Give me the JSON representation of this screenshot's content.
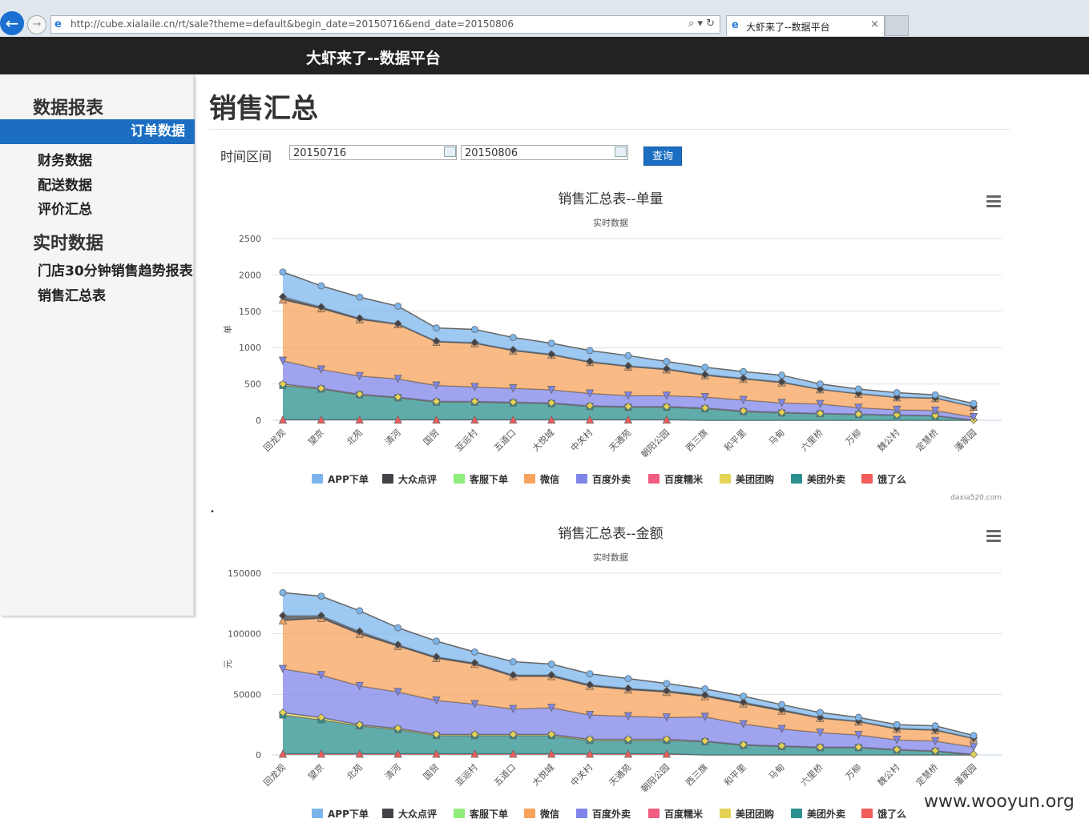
{
  "browser": {
    "url": "http://cube.xialaile.cn/rt/sale?theme=default&begin_date=20150716&end_date=20150806",
    "tab_title": "大虾来了--数据平台",
    "tab_close": "×",
    "search_glyph": "⌕ ▾ ↻"
  },
  "navbar": {
    "brand": "大虾来了--数据平台"
  },
  "sidebar": {
    "section1": "数据报表",
    "active_item": "订单数据",
    "items1": [
      "财务数据",
      "配送数据",
      "评价汇总"
    ],
    "section2": "实时数据",
    "items2": [
      "门店30分钟销售趋势报表",
      "销售汇总表"
    ]
  },
  "main": {
    "title": "销售汇总",
    "range_label": "时间区间",
    "begin_date": "20150716",
    "end_date": "20150806",
    "query_label": "查询",
    "bullet": "•",
    "credit": "daxia520.com"
  },
  "watermark": "www.wooyun.org",
  "colors": {
    "APP下单": "#7cb5ec",
    "大众点评": "#434348",
    "客服下单": "#90ed7d",
    "微信": "#f7a35c",
    "百度外卖": "#8085e9",
    "百度糯米": "#f15c80",
    "美团团购": "#e4d354",
    "美团外卖": "#2b908f",
    "饿了么": "#f45b5b"
  },
  "chart_data": [
    {
      "type": "area",
      "stacked": true,
      "title": "销售汇总表--单量",
      "subtitle": "实时数据",
      "ylabel": "单",
      "ylim": [
        0,
        2500
      ],
      "yticks": [
        0,
        500,
        1000,
        1500,
        2000,
        2500
      ],
      "grid": true,
      "legend_position": "bottom",
      "categories": [
        "回龙观",
        "望京",
        "北苑",
        "清河",
        "国贸",
        "亚运村",
        "五道口",
        "大悦城",
        "中关村",
        "天通苑",
        "朝阳公园",
        "西三旗",
        "和平里",
        "马甸",
        "六里桥",
        "万柳",
        "魏公村",
        "定慧桥",
        "潘家园"
      ],
      "series": [
        {
          "name": "APP下单",
          "values": [
            340,
            290,
            290,
            240,
            180,
            180,
            170,
            150,
            150,
            140,
            100,
            100,
            90,
            90,
            70,
            60,
            60,
            40,
            40
          ]
        },
        {
          "name": "大众点评",
          "values": [
            40,
            20,
            15,
            10,
            10,
            10,
            10,
            10,
            10,
            10,
            10,
            10,
            10,
            10,
            5,
            5,
            5,
            5,
            5
          ]
        },
        {
          "name": "客服下单",
          "values": [
            0,
            0,
            0,
            0,
            0,
            0,
            0,
            0,
            0,
            0,
            0,
            0,
            0,
            0,
            0,
            0,
            0,
            0,
            0
          ]
        },
        {
          "name": "微信",
          "values": [
            840,
            840,
            780,
            750,
            600,
            600,
            520,
            480,
            430,
            400,
            360,
            300,
            290,
            280,
            200,
            190,
            170,
            170,
            140
          ]
        },
        {
          "name": "百度外卖",
          "values": [
            320,
            260,
            250,
            250,
            220,
            200,
            190,
            180,
            170,
            150,
            150,
            150,
            150,
            130,
            130,
            90,
            70,
            70,
            40
          ]
        },
        {
          "name": "百度糯米",
          "values": [
            0,
            0,
            0,
            0,
            0,
            0,
            0,
            0,
            0,
            0,
            0,
            0,
            0,
            0,
            0,
            0,
            0,
            0,
            0
          ]
        },
        {
          "name": "美团团购",
          "values": [
            20,
            10,
            10,
            10,
            10,
            10,
            10,
            10,
            10,
            10,
            10,
            10,
            10,
            10,
            5,
            5,
            5,
            5,
            5
          ]
        },
        {
          "name": "美团外卖",
          "values": [
            470,
            420,
            340,
            300,
            240,
            240,
            230,
            220,
            180,
            170,
            170,
            160,
            120,
            100,
            90,
            80,
            70,
            60,
            0
          ]
        },
        {
          "name": "饿了么",
          "values": [
            10,
            10,
            10,
            10,
            10,
            10,
            10,
            10,
            10,
            10,
            10,
            0,
            0,
            0,
            0,
            0,
            0,
            0,
            0
          ]
        }
      ]
    },
    {
      "type": "area",
      "stacked": true,
      "title": "销售汇总表--金额",
      "subtitle": "实时数据",
      "ylabel": "元",
      "ylim": [
        0,
        150000
      ],
      "yticks": [
        0,
        50000,
        100000,
        150000
      ],
      "grid": true,
      "legend_position": "bottom",
      "categories": [
        "回龙观",
        "望京",
        "北苑",
        "清河",
        "国贸",
        "亚运村",
        "五道口",
        "大悦城",
        "中关村",
        "天通苑",
        "朝阳公园",
        "西三旗",
        "和平里",
        "马甸",
        "六里桥",
        "万柳",
        "魏公村",
        "定慧桥",
        "潘家园"
      ],
      "series": [
        {
          "name": "APP下单",
          "values": [
            19000,
            16000,
            17000,
            14000,
            13000,
            9000,
            11000,
            9000,
            9000,
            8000,
            6000,
            5000,
            5000,
            4000,
            4000,
            3000,
            3000,
            3000,
            2000
          ]
        },
        {
          "name": "大众点评",
          "values": [
            4000,
            2000,
            2000,
            1000,
            1000,
            1000,
            1000,
            1000,
            1000,
            1000,
            1000,
            1000,
            1000,
            1000,
            500,
            500,
            500,
            500,
            500
          ]
        },
        {
          "name": "客服下单",
          "values": [
            0,
            0,
            0,
            0,
            0,
            0,
            0,
            0,
            0,
            0,
            0,
            0,
            0,
            0,
            0,
            0,
            0,
            0,
            0
          ]
        },
        {
          "name": "微信",
          "values": [
            40000,
            47000,
            43000,
            38000,
            35000,
            33000,
            27000,
            26000,
            24000,
            22000,
            21000,
            17000,
            17000,
            15000,
            12000,
            11000,
            9000,
            9000,
            7000
          ]
        },
        {
          "name": "百度外卖",
          "values": [
            36000,
            35000,
            32000,
            30000,
            28000,
            25000,
            21000,
            22000,
            20000,
            19000,
            18000,
            20000,
            17000,
            14000,
            12000,
            10000,
            8000,
            8000,
            6000
          ]
        },
        {
          "name": "百度糯米",
          "values": [
            0,
            0,
            0,
            0,
            0,
            0,
            0,
            0,
            0,
            0,
            0,
            0,
            0,
            0,
            0,
            0,
            0,
            0,
            0
          ]
        },
        {
          "name": "美团团购",
          "values": [
            2000,
            2000,
            1000,
            1000,
            1000,
            1000,
            1000,
            1000,
            1000,
            1000,
            1000,
            500,
            500,
            500,
            500,
            500,
            500,
            500,
            500
          ]
        },
        {
          "name": "美团外卖",
          "values": [
            32000,
            28000,
            23000,
            20000,
            15000,
            15000,
            15000,
            15000,
            11000,
            11000,
            11000,
            11000,
            8000,
            7000,
            6000,
            6000,
            4000,
            3000,
            0
          ]
        },
        {
          "name": "饿了么",
          "values": [
            1000,
            1000,
            1000,
            1000,
            1000,
            1000,
            1000,
            1000,
            1000,
            1000,
            1000,
            0,
            0,
            0,
            0,
            0,
            0,
            0,
            0
          ]
        }
      ]
    }
  ]
}
